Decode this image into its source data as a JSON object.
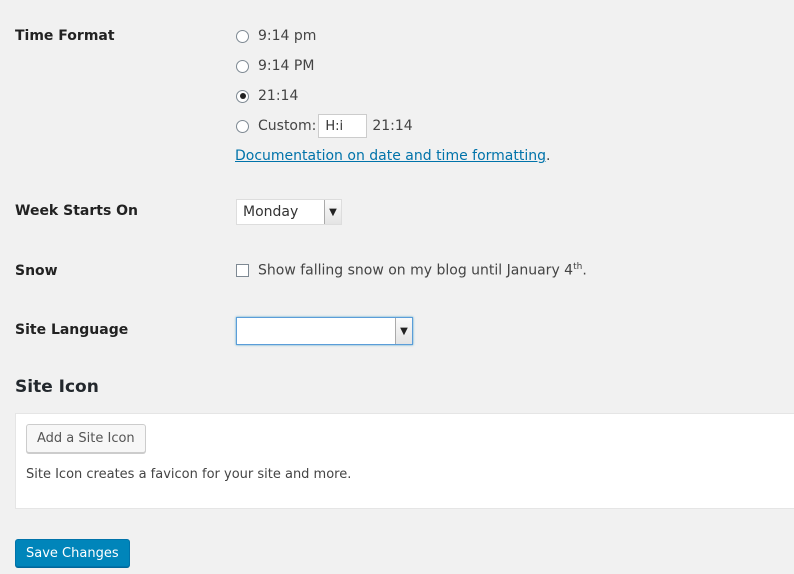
{
  "time_format": {
    "label": "Time Format",
    "options": [
      {
        "text": "9:14 pm",
        "checked": false
      },
      {
        "text": "9:14 PM",
        "checked": false
      },
      {
        "text": "21:14",
        "checked": true
      },
      {
        "text": "Custom:",
        "checked": false
      }
    ],
    "custom_value": "H:i",
    "custom_preview": "21:14",
    "doc_link": "Documentation on date and time formatting",
    "doc_link_suffix": "."
  },
  "week_starts_on": {
    "label": "Week Starts On",
    "selected": "Monday"
  },
  "snow": {
    "label": "Snow",
    "checkbox_text": "Show falling snow on my blog until January 4",
    "superscript": "th",
    "suffix": ".",
    "checked": false
  },
  "site_language": {
    "label": "Site Language",
    "selected": ""
  },
  "site_icon": {
    "title": "Site Icon",
    "button": "Add a Site Icon",
    "description": "Site Icon creates a favicon for your site and more."
  },
  "save_button": "Save Changes",
  "colors": {
    "primary": "#0085ba",
    "link": "#0073aa",
    "background": "#f1f1f1"
  }
}
